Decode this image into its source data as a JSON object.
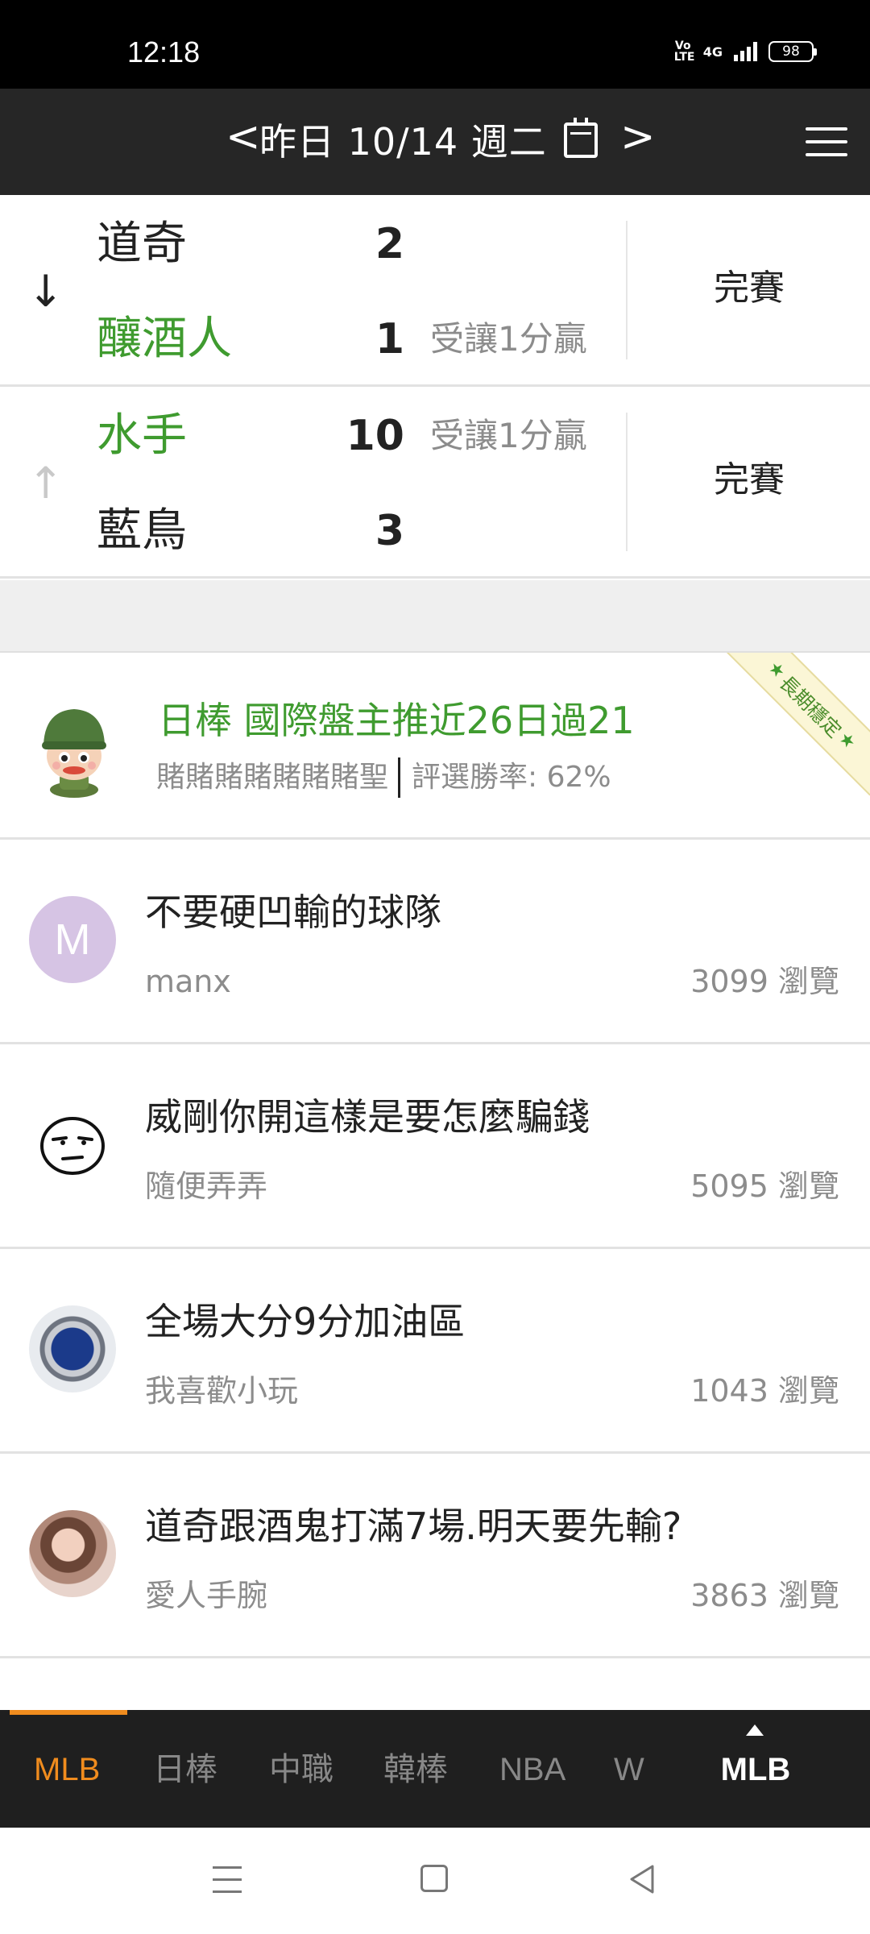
{
  "status_bar": {
    "time": "12:18",
    "volte": "Vo LTE",
    "network": "4G",
    "battery": "98"
  },
  "header": {
    "prev_glyph": "<",
    "date": "昨日 10/14 週二",
    "next_glyph": ">"
  },
  "games": [
    {
      "arrow": "↓",
      "team1": {
        "name": "道奇",
        "score": "2",
        "handicap": ""
      },
      "team2": {
        "name": "釀酒人",
        "score": "1",
        "handicap": "受讓1分贏"
      },
      "status": "完賽"
    },
    {
      "arrow": "↑",
      "team1": {
        "name": "水手",
        "score": "10",
        "handicap": "受讓1分贏"
      },
      "team2": {
        "name": "藍鳥",
        "score": "3",
        "handicap": ""
      },
      "status": "完賽"
    }
  ],
  "featured": {
    "title": "日棒 國際盤主推近26日過21",
    "author": "賭賭賭賭賭賭賭聖",
    "win_rate": "評選勝率: 62%",
    "ribbon": "長期穩定"
  },
  "posts": [
    {
      "title": "不要硬凹輸的球隊",
      "author": "manx",
      "views": "3099 瀏覽",
      "avatar_letter": "M"
    },
    {
      "title": "威剛你開這樣是要怎麼騙錢",
      "author": "隨便弄弄",
      "views": "5095 瀏覽"
    },
    {
      "title": "全場大分9分加油區",
      "author": "我喜歡小玩",
      "views": "1043 瀏覽"
    },
    {
      "title": "道奇跟酒鬼打滿7場.明天要先輸?",
      "author": "愛人手腕",
      "views": "3863 瀏覽"
    }
  ],
  "tabs": {
    "items": [
      "MLB",
      "日棒",
      "中職",
      "韓棒",
      "NBA",
      "W"
    ],
    "active": "MLB",
    "more_label": "MLB"
  },
  "colors": {
    "accent": "#f08c1e",
    "winner": "#3f9b2f",
    "header_bg": "#262626"
  }
}
